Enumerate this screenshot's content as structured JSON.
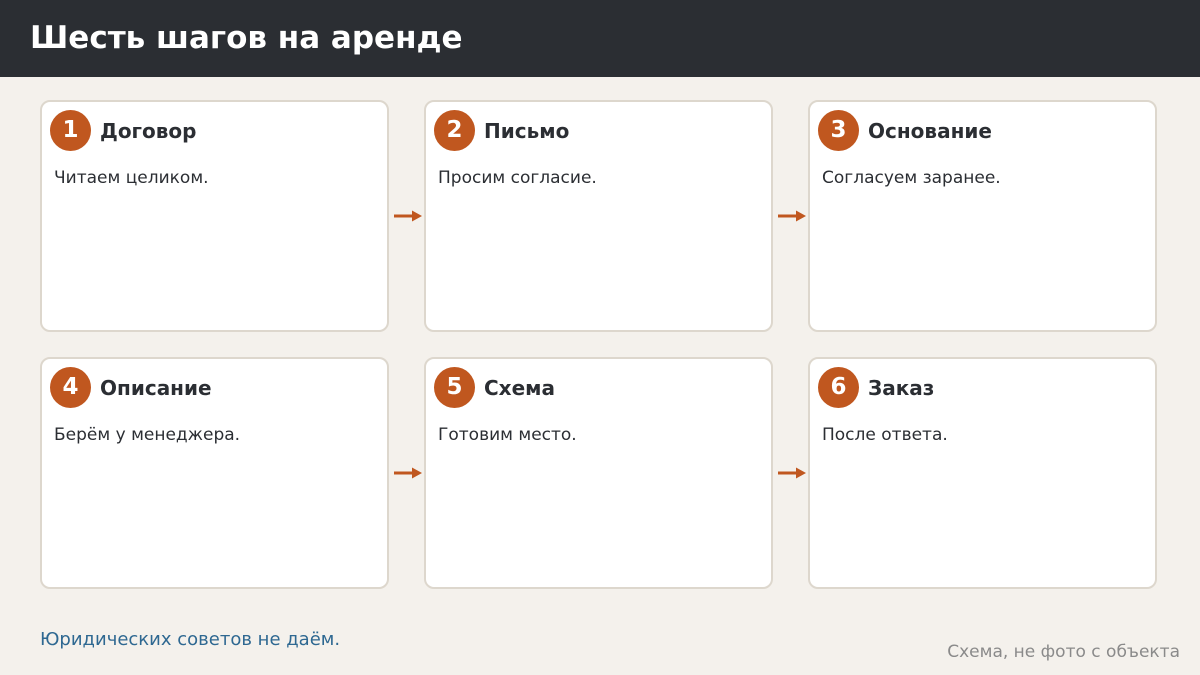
{
  "title": "Шесть шагов на аренде",
  "steps": [
    {
      "number": "1",
      "title": "Договор",
      "description": "Читаем целиком."
    },
    {
      "number": "2",
      "title": "Письмо",
      "description": "Просим согласие."
    },
    {
      "number": "3",
      "title": "Основание",
      "description": "Согласуем заранее."
    },
    {
      "number": "4",
      "title": "Описание",
      "description": "Берём у менеджера."
    },
    {
      "number": "5",
      "title": "Схема",
      "description": "Готовим место."
    },
    {
      "number": "6",
      "title": "Заказ",
      "description": "После ответа."
    }
  ],
  "footnote": "Юридических советов не даём.",
  "caption": "Схема, не фото с объекта",
  "colors": {
    "header_bg": "#2b2e33",
    "accent": "#c0571f",
    "page_bg": "#f4f1ec",
    "card_border": "#ddd7cd",
    "footnote_text": "#2e6891",
    "caption_text": "#8a8a8a"
  },
  "icons": {
    "connector": "arrow-right-icon"
  }
}
